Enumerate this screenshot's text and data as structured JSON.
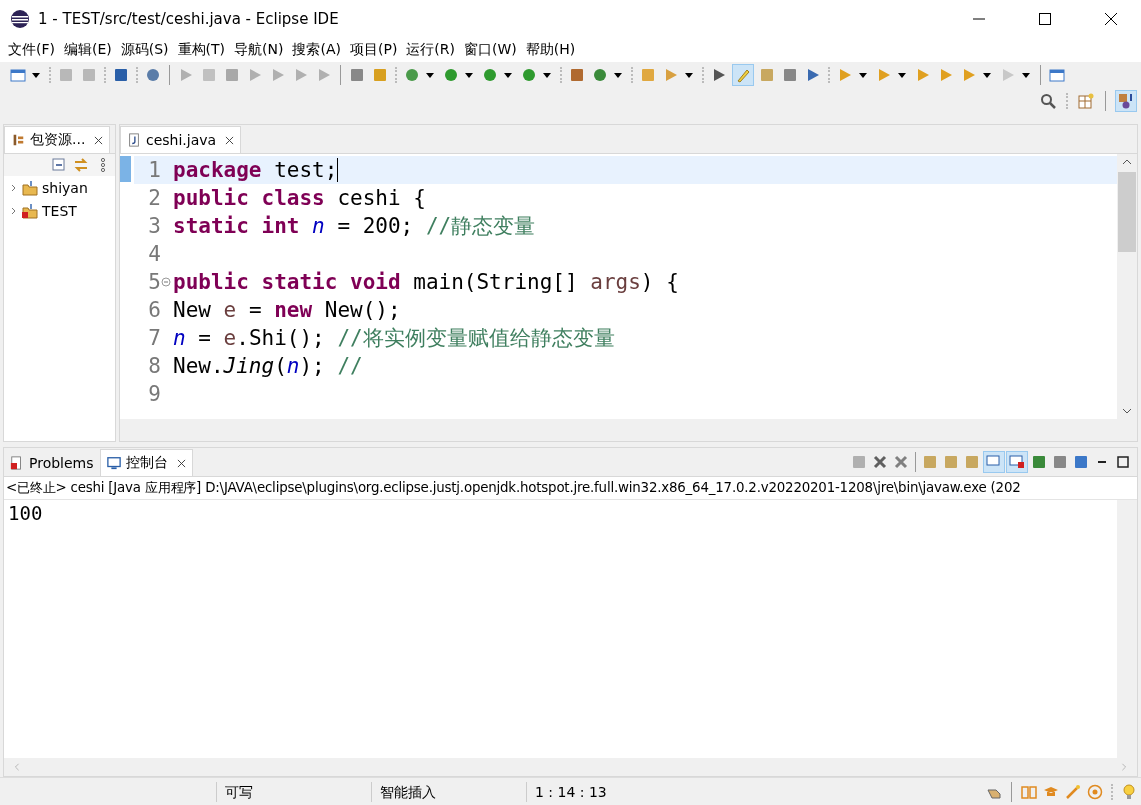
{
  "window": {
    "title": "1 - TEST/src/test/ceshi.java - Eclipse IDE"
  },
  "menu": [
    "文件(F)",
    "编辑(E)",
    "源码(S)",
    "重构(T)",
    "导航(N)",
    "搜索(A)",
    "项目(P)",
    "运行(R)",
    "窗口(W)",
    "帮助(H)"
  ],
  "toolbar": {
    "highlight_toggle_on": true,
    "java_perspective_selected": true
  },
  "package_explorer": {
    "tab": "包资源...",
    "items": [
      {
        "label": "shiyan",
        "expanded": false,
        "has_error": false
      },
      {
        "label": "TEST",
        "expanded": false,
        "has_error": true
      }
    ]
  },
  "editor": {
    "tabs": [
      {
        "label": "ceshi.java",
        "selected": true
      }
    ],
    "lines": [
      {
        "number": "1",
        "current": true,
        "foldable": false,
        "tokens": [
          {
            "kind": "keyword",
            "text": "package"
          },
          {
            "kind": "plain",
            "text": " test;"
          }
        ]
      },
      {
        "number": "2",
        "current": false,
        "foldable": false,
        "tokens": [
          {
            "kind": "keyword",
            "text": "public "
          },
          {
            "kind": "keyword",
            "text": "class"
          },
          {
            "kind": "plain",
            "text": " ceshi {"
          }
        ]
      },
      {
        "number": "3",
        "current": false,
        "foldable": false,
        "tokens": [
          {
            "kind": "keyword",
            "text": "static "
          },
          {
            "kind": "keyword",
            "text": "int "
          },
          {
            "kind": "field",
            "text": "n"
          },
          {
            "kind": "plain",
            "text": " = 200; "
          },
          {
            "kind": "comment",
            "text": "//静态变量"
          }
        ]
      },
      {
        "number": "4",
        "current": false,
        "foldable": false
      },
      {
        "number": "5",
        "current": false,
        "foldable": true,
        "tokens": [
          {
            "kind": "keyword",
            "text": "public "
          },
          {
            "kind": "keyword",
            "text": "static "
          },
          {
            "kind": "keyword",
            "text": "void"
          },
          {
            "kind": "plain",
            "text": " main(String[] "
          },
          {
            "kind": "local",
            "text": "args"
          },
          {
            "kind": "plain",
            "text": ") {"
          }
        ]
      },
      {
        "number": "6",
        "current": false,
        "foldable": false,
        "tokens": [
          {
            "kind": "plain",
            "text": "New "
          },
          {
            "kind": "local",
            "text": "e"
          },
          {
            "kind": "plain",
            "text": " = "
          },
          {
            "kind": "keyword",
            "text": "new"
          },
          {
            "kind": "plain",
            "text": " New();"
          }
        ]
      },
      {
        "number": "7",
        "current": false,
        "foldable": false,
        "tokens": [
          {
            "kind": "field",
            "text": "n"
          },
          {
            "kind": "plain",
            "text": " = "
          },
          {
            "kind": "local",
            "text": "e"
          },
          {
            "kind": "plain",
            "text": ".Shi(); "
          },
          {
            "kind": "comment",
            "text": "//将实例变量赋值给静态变量"
          }
        ]
      },
      {
        "number": "8",
        "current": false,
        "foldable": false,
        "tokens": [
          {
            "kind": "plain",
            "text": "New."
          },
          {
            "kind": "static-method",
            "text": "Jing"
          },
          {
            "kind": "plain",
            "text": "("
          },
          {
            "kind": "field",
            "text": "n"
          },
          {
            "kind": "plain",
            "text": "); "
          },
          {
            "kind": "comment",
            "text": "//"
          }
        ]
      },
      {
        "number": "9",
        "current": false,
        "foldable": false
      }
    ]
  },
  "bottom_panel": {
    "tabs": [
      {
        "label": "Problems",
        "selected": false
      },
      {
        "label": "控制台",
        "selected": true
      }
    ],
    "console_toggles": [
      {
        "on": true
      },
      {
        "on": true
      }
    ],
    "console_header": "<已终止> ceshi [Java 应用程序] D:\\JAVA\\eclipse\\plugins\\org.eclipse.justj.openjdk.hotspot.jre.full.win32.x86_64_17.0.2.v20220201-1208\\jre\\bin\\javaw.exe  (202",
    "output": "100"
  },
  "status_bar": [
    "可写",
    "智能插入",
    "1 : 14 : 13"
  ]
}
